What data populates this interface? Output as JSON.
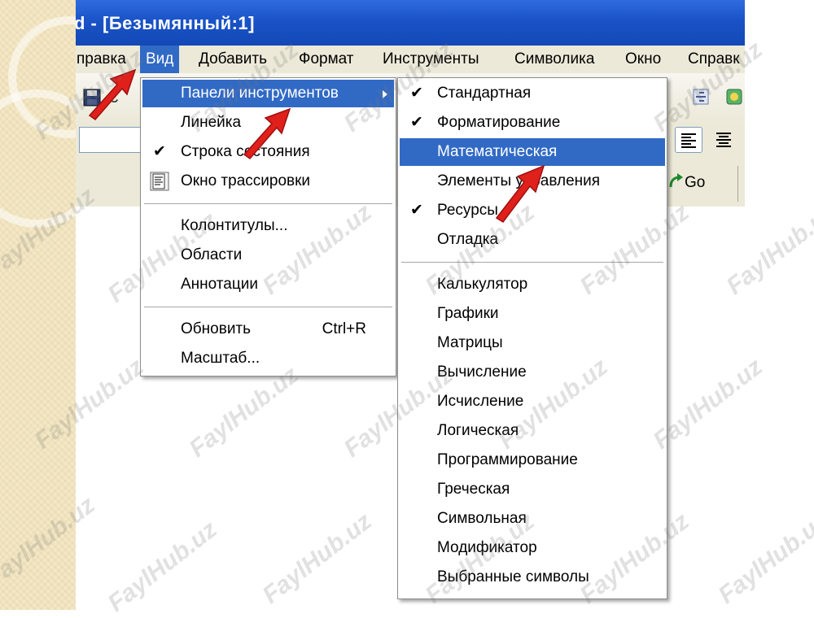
{
  "window": {
    "title": "d - [Безымянный:1]"
  },
  "menubar": [
    {
      "label": "правка",
      "name": "menu-edit"
    },
    {
      "label": "Вид",
      "name": "menu-view"
    },
    {
      "label": "Добавить",
      "name": "menu-insert"
    },
    {
      "label": "Формат",
      "name": "menu-format"
    },
    {
      "label": "Инструменты",
      "name": "menu-tools"
    },
    {
      "label": "Символика",
      "name": "menu-symbolics"
    },
    {
      "label": "Окно",
      "name": "menu-window"
    },
    {
      "label": "Справк",
      "name": "menu-help"
    }
  ],
  "toolbar": {
    "go_label": "Go"
  },
  "view_menu": {
    "items": [
      {
        "label": "Панели инструментов",
        "has_submenu": true,
        "highlighted": true
      },
      {
        "label": "Линейка"
      },
      {
        "label": "Строка состояния",
        "checked": true
      },
      {
        "label": "Окно трассировки",
        "icon": "trace-window-icon"
      },
      {
        "label": "Колонтитулы..."
      },
      {
        "label": "Области"
      },
      {
        "label": "Аннотации"
      },
      {
        "label": "Обновить",
        "shortcut": "Ctrl+R"
      },
      {
        "label": "Масштаб..."
      }
    ]
  },
  "toolbars_submenu": {
    "items": [
      {
        "label": "Стандартная",
        "checked": true
      },
      {
        "label": "Форматирование",
        "checked": true
      },
      {
        "label": "Математическая",
        "highlighted": true
      },
      {
        "label": "Элементы управления"
      },
      {
        "label": "Ресурсы",
        "checked": true
      },
      {
        "label": "Отладка"
      },
      {
        "label": "Калькулятор"
      },
      {
        "label": "Графики"
      },
      {
        "label": "Матрицы"
      },
      {
        "label": "Вычисление"
      },
      {
        "label": "Исчисление"
      },
      {
        "label": "Логическая"
      },
      {
        "label": "Программирование"
      },
      {
        "label": "Греческая"
      },
      {
        "label": "Символьная"
      },
      {
        "label": "Модификатор"
      },
      {
        "label": "Выбранные символы"
      }
    ]
  },
  "watermark": "FaylHub.uz",
  "colors": {
    "highlight": "#316ac5",
    "titlebar": "#1a53c7",
    "chrome": "#ece9d8",
    "arrow": "#e0201b"
  }
}
